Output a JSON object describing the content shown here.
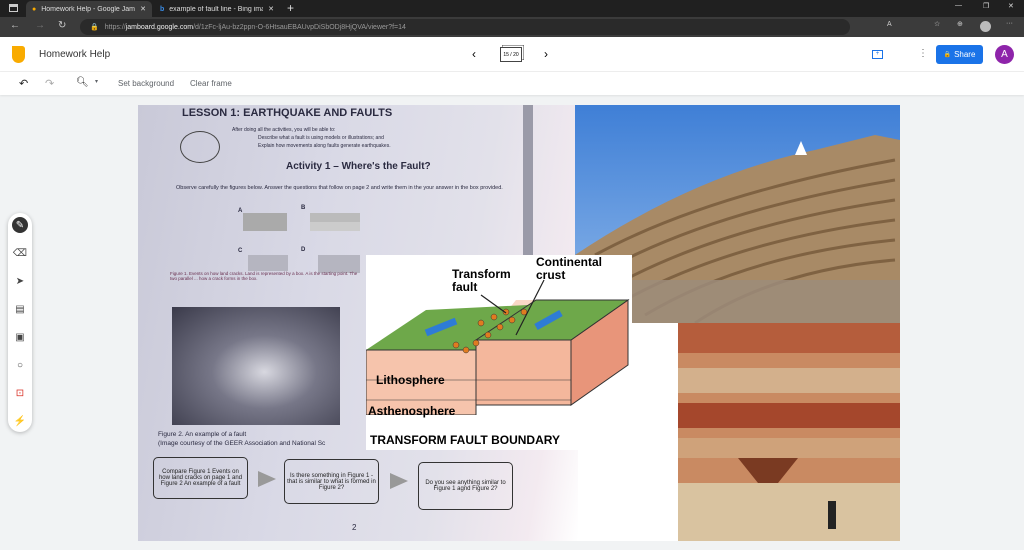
{
  "browser": {
    "tabs": [
      {
        "title": "Homework Help - Google Jambo",
        "active": true
      },
      {
        "title": "example of fault line - Bing imag",
        "active": false
      }
    ],
    "url_prefix": "https://",
    "url_domain": "jamboard.google.com",
    "url_path": "/d/1zFc-ljAu-bz2ppn-O-6HtsauEBAUvpDiSbODj8HjQVA/viewer?f=14"
  },
  "app": {
    "title": "Homework Help",
    "frame_counter": "15 / 20",
    "share_label": "Share",
    "avatar_initial": "A",
    "accent": "#1a73e8",
    "avatar_color": "#8e24aa"
  },
  "toolbar": {
    "set_background": "Set background",
    "clear_frame": "Clear frame"
  },
  "worksheet": {
    "lesson_title": "LESSON 1: EARTHQUAKE AND FAULTS",
    "intro": "After doing all the activities, you will be able to:",
    "objectives": [
      "Describe what a fault is using models or illustrations; and",
      "Explain how movements along faults generate earthquakes."
    ],
    "activity_title": "Activity 1 – Where's the Fault?",
    "instructions": "Observe carefully the figures below. Answer the questions that follow on page 2 and write them in the your answer in the box provided.",
    "figure_labels": [
      "A",
      "B",
      "C",
      "D"
    ],
    "figure1_caption": "Figure 1. Events on how land cracks. Land is represented by a box. A is the starting point. The two parallel ... how a crack forms in the box.",
    "figure2_caption": "Figure 2. An example of a fault",
    "figure2_credit": "(Image courtesy of the GEER Association and National Sc",
    "boxes": [
      "Compare Figure 1 Events on how land cracks on page 1 and Figure 2 An example of a fault",
      "Is there something in Figure 1 - that is similar to what is formed in Figure 2?",
      "Do you see anything similar to Figure 1 agnd Figure 2?"
    ],
    "page_number": "2"
  },
  "diagram": {
    "label_transform": "Transform fault",
    "label_crust": "Continental crust",
    "label_litho": "Lithosphere",
    "label_astheno": "Asthenosphere",
    "caption": "TRANSFORM FAULT BOUNDARY"
  }
}
